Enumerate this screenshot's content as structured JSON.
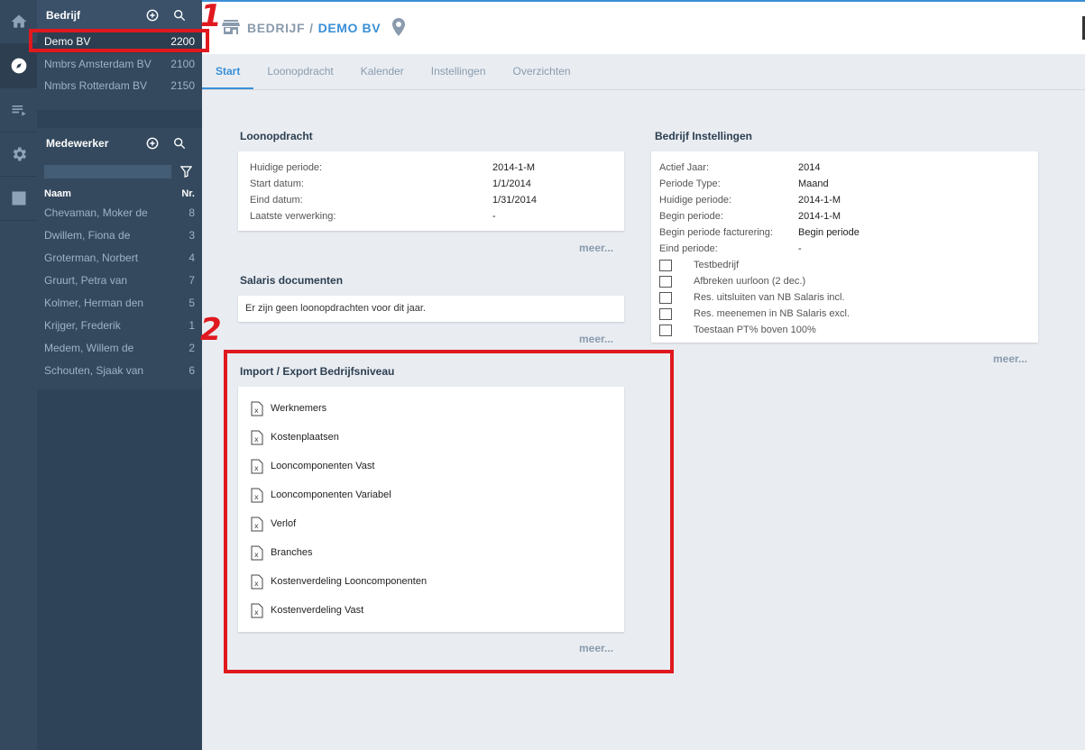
{
  "rail": {
    "items": [
      {
        "icon": "home-icon"
      },
      {
        "icon": "compass-icon"
      },
      {
        "icon": "list-icon"
      },
      {
        "icon": "gear-icon"
      },
      {
        "icon": "chart-icon"
      }
    ]
  },
  "sidebar": {
    "companies_title": "Bedrijf",
    "companies": [
      {
        "name": "Demo BV",
        "nr": "2200"
      },
      {
        "name": "Nmbrs Amsterdam BV",
        "nr": "2100"
      },
      {
        "name": "Nmbrs Rotterdam BV",
        "nr": "2150"
      }
    ],
    "employees_title": "Medewerker",
    "col_name": "Naam",
    "col_nr": "Nr.",
    "employees": [
      {
        "name": "Chevaman, Moker de",
        "nr": "8"
      },
      {
        "name": "Dwillem, Fiona de",
        "nr": "3"
      },
      {
        "name": "Groterman, Norbert",
        "nr": "4"
      },
      {
        "name": "Gruurt, Petra van",
        "nr": "7"
      },
      {
        "name": "Kolmer, Herman den",
        "nr": "5"
      },
      {
        "name": "Krijger, Frederik",
        "nr": "1"
      },
      {
        "name": "Medem, Willem de",
        "nr": "2"
      },
      {
        "name": "Schouten, Sjaak van",
        "nr": "6"
      }
    ]
  },
  "header": {
    "crumb_root": "BEDRIJF",
    "crumb_sep": "/",
    "crumb_current": "DEMO BV"
  },
  "tabs": [
    {
      "label": "Start"
    },
    {
      "label": "Loonopdracht"
    },
    {
      "label": "Kalender"
    },
    {
      "label": "Instellingen"
    },
    {
      "label": "Overzichten"
    }
  ],
  "loonopdracht": {
    "title": "Loonopdracht",
    "rows": [
      {
        "k": "Huidige periode:",
        "v": "2014-1-M"
      },
      {
        "k": "Start datum:",
        "v": "1/1/2014"
      },
      {
        "k": "Eind datum:",
        "v": "1/31/2014"
      },
      {
        "k": "Laatste verwerking:",
        "v": "-"
      }
    ],
    "meer": "meer..."
  },
  "salaris": {
    "title": "Salaris documenten",
    "empty": "Er zijn geen loonopdrachten voor dit jaar.",
    "meer": "meer..."
  },
  "import_export": {
    "title": "Import / Export Bedrijfsniveau",
    "files": [
      "Werknemers",
      "Kostenplaatsen",
      "Looncomponenten Vast",
      "Looncomponenten Variabel",
      "Verlof",
      "Branches",
      "Kostenverdeling Looncomponenten",
      "Kostenverdeling Vast"
    ],
    "meer": "meer..."
  },
  "instellingen": {
    "title": "Bedrijf Instellingen",
    "rows": [
      {
        "k": "Actief Jaar:",
        "v": "2014"
      },
      {
        "k": "Periode Type:",
        "v": "Maand"
      },
      {
        "k": "Huidige periode:",
        "v": "2014-1-M"
      },
      {
        "k": "Begin periode:",
        "v": "2014-1-M"
      },
      {
        "k": "Begin periode facturering:",
        "v": "Begin periode"
      },
      {
        "k": "Eind periode:",
        "v": "-"
      }
    ],
    "checkboxes": [
      "Testbedrijf",
      "Afbreken uurloon (2 dec.)",
      "Res. uitsluiten van NB Salaris incl.",
      "Res. meenemen in NB Salaris excl.",
      "Toestaan PT% boven 100%"
    ],
    "meer": "meer..."
  },
  "annotations": {
    "marker1": "1",
    "marker2": "2",
    "color": "#e0191f"
  }
}
